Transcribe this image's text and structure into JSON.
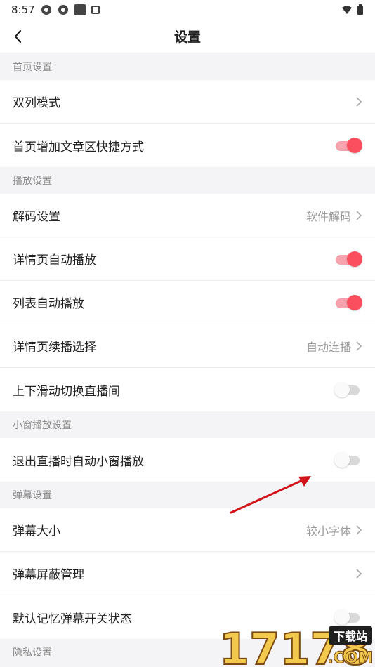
{
  "status": {
    "time": "8:57"
  },
  "header": {
    "title": "设置"
  },
  "sections": [
    {
      "title": "首页设置"
    },
    {
      "title": "播放设置"
    },
    {
      "title": "小窗播放设置"
    },
    {
      "title": "弹幕设置"
    },
    {
      "title": "隐私设置"
    }
  ],
  "rows": {
    "double_column": {
      "label": "双列模式"
    },
    "home_shortcut": {
      "label": "首页增加文章区快捷方式",
      "enabled": true
    },
    "decode": {
      "label": "解码设置",
      "value": "软件解码"
    },
    "detail_autoplay": {
      "label": "详情页自动播放",
      "enabled": true
    },
    "list_autoplay": {
      "label": "列表自动播放",
      "enabled": true
    },
    "detail_continue": {
      "label": "详情页续播选择",
      "value": "自动连播"
    },
    "swipe_live": {
      "label": "上下滑动切换直播间",
      "enabled": false
    },
    "exit_live_mini": {
      "label": "退出直播时自动小窗播放",
      "enabled": false
    },
    "danmaku_size": {
      "label": "弹幕大小",
      "value": "较小字体"
    },
    "danmaku_block": {
      "label": "弹幕屏蔽管理"
    },
    "danmaku_remember": {
      "label": "默认记忆弹幕开关状态",
      "enabled": false
    }
  },
  "watermark": {
    "text": "17178",
    "badge": "下载站",
    "domain": ".COM"
  },
  "colors": {
    "accent": "#fb4f5f",
    "toggle_on_track": "#f7a3ad",
    "annotation_arrow": "#d0141a"
  }
}
